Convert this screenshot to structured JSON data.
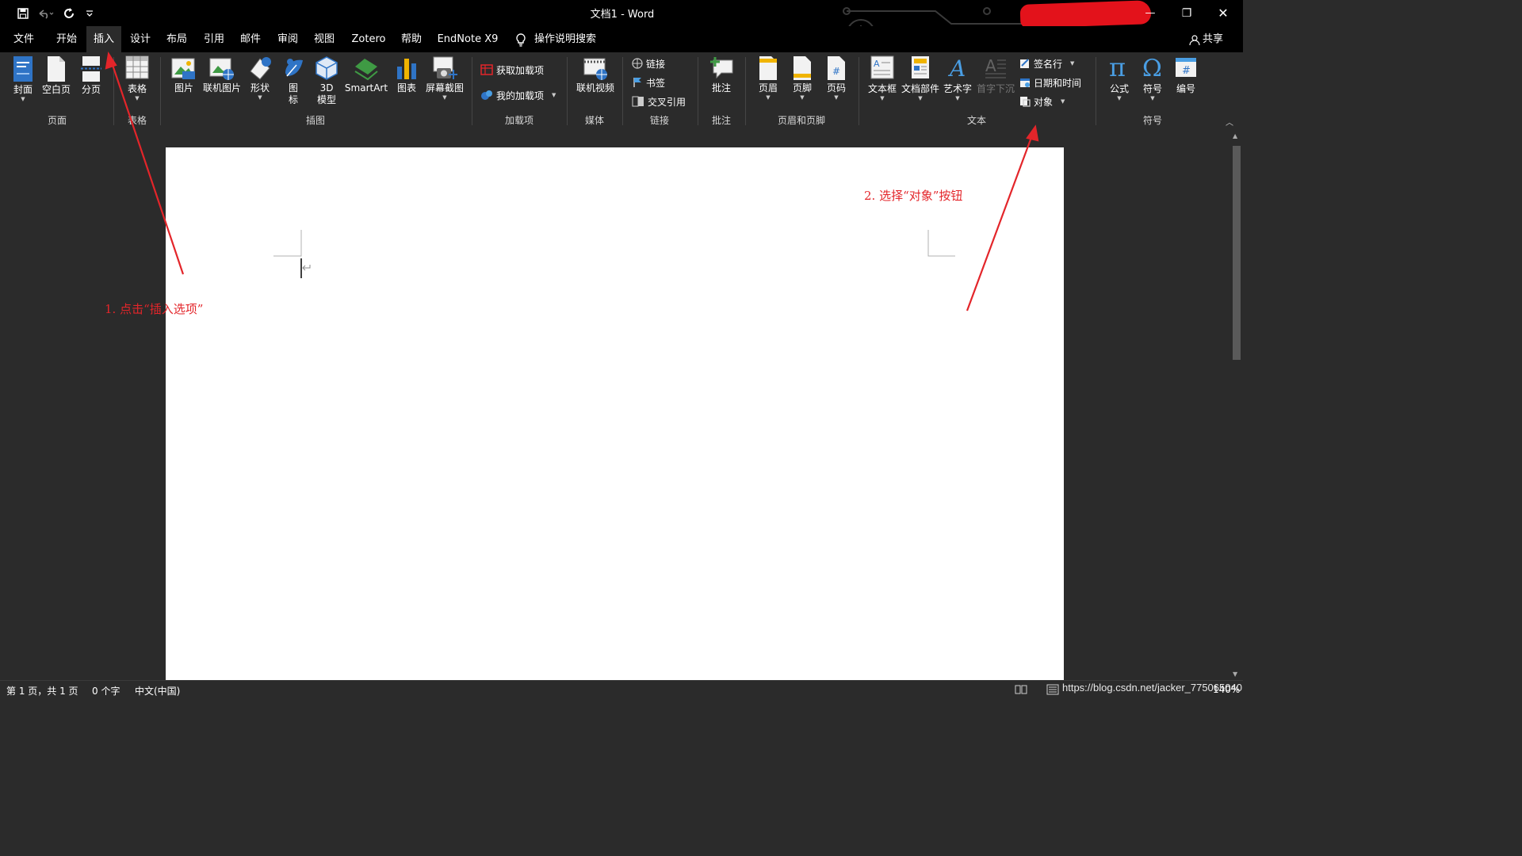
{
  "window": {
    "title": "文档1  -  Word",
    "minimize_glyph": "—",
    "restore_glyph": "❐",
    "close_glyph": "✕"
  },
  "qat": {
    "icons": [
      "save-icon",
      "undo-icon",
      "redo-icon",
      "customize-icon"
    ]
  },
  "menu": {
    "tabs": [
      {
        "label": "文件"
      },
      {
        "label": "开始"
      },
      {
        "label": "插入",
        "active": true
      },
      {
        "label": "设计"
      },
      {
        "label": "布局"
      },
      {
        "label": "引用"
      },
      {
        "label": "邮件"
      },
      {
        "label": "审阅"
      },
      {
        "label": "视图"
      },
      {
        "label": "Zotero"
      },
      {
        "label": "帮助"
      },
      {
        "label": "EndNote X9"
      }
    ],
    "search_label": "操作说明搜索",
    "share_label": "共享"
  },
  "ribbon": {
    "groups": {
      "pages": "页面",
      "tables": "表格",
      "illustrations": "插图",
      "addins": "加载项",
      "media": "媒体",
      "links": "链接",
      "comments": "批注",
      "header_footer": "页眉和页脚",
      "text": "文本",
      "symbols": "符号"
    },
    "buttons": {
      "cover": "封面",
      "blank_page": "空白页",
      "page_break": "分页",
      "table": "表格",
      "picture": "图片",
      "online_picture": "联机图片",
      "shapes": "形状",
      "icons_1": "图",
      "icons_2": "标",
      "model3d_1": "3D",
      "model3d_2": "模型",
      "smartart": "SmartArt",
      "chart": "图表",
      "screenshot": "屏幕截图",
      "get_addins": "获取加载项",
      "my_addins": "我的加载项",
      "online_video": "联机视频",
      "link": "链接",
      "bookmark": "书签",
      "cross_reference": "交叉引用",
      "comment": "批注",
      "header": "页眉",
      "footer": "页脚",
      "page_number": "页码",
      "textbox": "文本框",
      "quick_parts": "文档部件",
      "wordart": "艺术字",
      "drop_cap": "首字下沉",
      "signature_line": "签名行",
      "date_time": "日期和时间",
      "object": "对象",
      "equation": "公式",
      "symbol": "符号",
      "number": "编号"
    }
  },
  "status": {
    "page": "第 1 页，共 1 页",
    "words": "0 个字",
    "language": "中文(中国)",
    "watermark": "https://blog.csdn.net/jacker_775065040",
    "zoom": "140%"
  },
  "annotations": {
    "step1": "1. 点击“插入选项”",
    "step2": "2. 选择“对象”按钮"
  },
  "colors": {
    "accent_blue": "#4a9ee3",
    "annotation_red": "#e3252a",
    "ribbon_bg": "#2b2b2b",
    "titlebar_bg": "#000000"
  }
}
